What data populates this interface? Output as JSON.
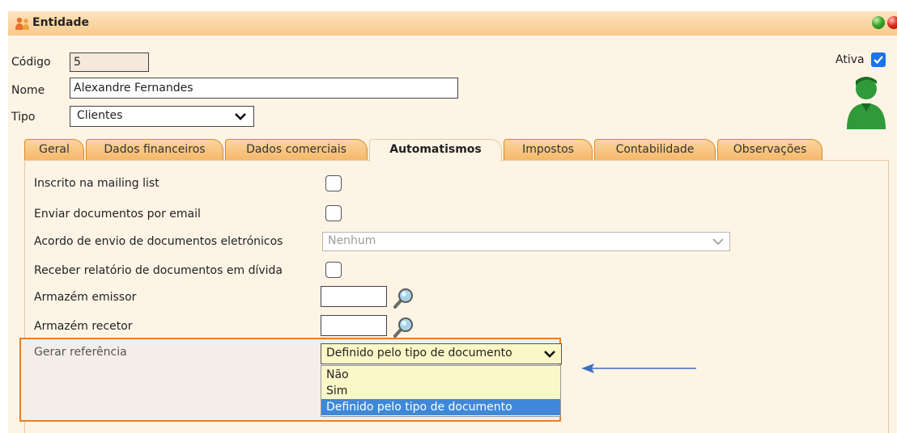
{
  "window": {
    "title": "Entidade",
    "icon": "people-icon"
  },
  "form": {
    "codigo_label": "Código",
    "codigo_value": "5",
    "nome_label": "Nome",
    "nome_value": "Alexandre Fernandes",
    "tipo_label": "Tipo",
    "tipo_value": "Clientes",
    "ativa_label": "Ativa",
    "ativa_checked": true
  },
  "tabs": [
    {
      "label": "Geral"
    },
    {
      "label": "Dados financeiros"
    },
    {
      "label": "Dados comerciais"
    },
    {
      "label": "Automatismos",
      "active": true
    },
    {
      "label": "Impostos"
    },
    {
      "label": "Contabilidade"
    },
    {
      "label": "Observações"
    }
  ],
  "automatismos": {
    "mailing_label": "Inscrito na mailing list",
    "mailing_checked": false,
    "enviar_label": "Enviar documentos por email",
    "enviar_checked": false,
    "acordo_label": "Acordo de envio de documentos eletrónicos",
    "acordo_value": "Nenhum",
    "receber_label": "Receber relatório de documentos em dívida",
    "receber_checked": false,
    "emissor_label": "Armazém emissor",
    "emissor_value": "",
    "recetor_label": "Armazém recetor",
    "recetor_value": "",
    "gerar_label": "Gerar referência",
    "gerar_value": "Definido pelo tipo de documento",
    "gerar_options": [
      "Não",
      "Sim",
      "Definido pelo tipo de documento"
    ],
    "gerar_selected_index": 2
  },
  "colors": {
    "title_bar": "#f8c98c",
    "panel_bg": "#fdf4e6",
    "tab_bg": "#f5b86a",
    "highlight_border": "#ef7d22",
    "dropdown_bg": "#fbf7c7",
    "selected_option": "#3f87d9",
    "arrow": "#3b6fc4"
  }
}
